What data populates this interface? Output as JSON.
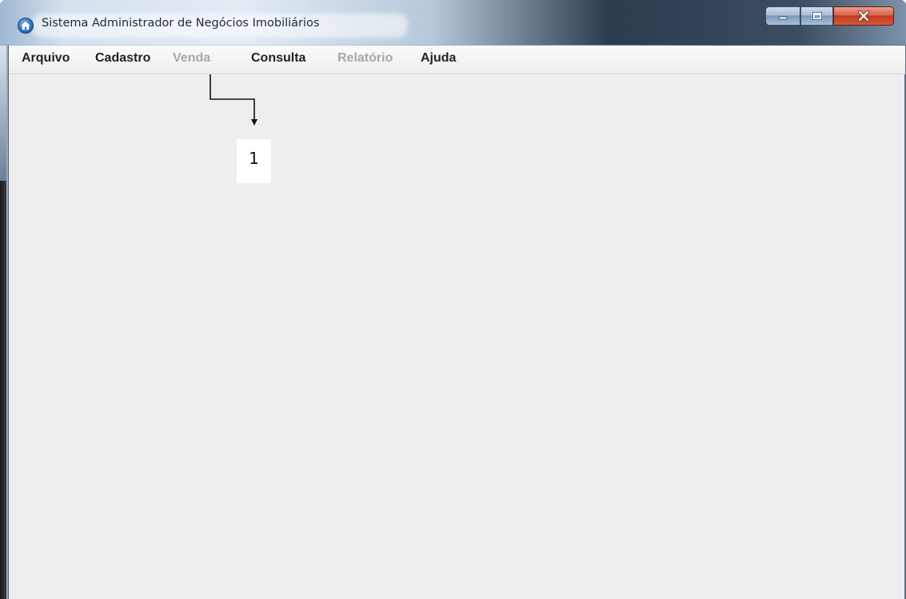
{
  "window": {
    "title": "Sistema Administrador de Negócios Imobiliários",
    "controls": {
      "minimize": "minimize-icon",
      "maximize": "maximize-icon",
      "close": "close-icon"
    }
  },
  "menubar": {
    "items": [
      {
        "label": "Arquivo",
        "enabled": true
      },
      {
        "label": "Cadastro",
        "enabled": true
      },
      {
        "label": "Venda",
        "enabled": false
      },
      {
        "label": "Consulta",
        "enabled": true
      },
      {
        "label": "Relatório",
        "enabled": false
      },
      {
        "label": "Ajuda",
        "enabled": true
      }
    ]
  },
  "annotation": {
    "number": "1"
  },
  "colors": {
    "menu_enabled": "#222222",
    "menu_disabled": "#a8a8a8",
    "client_background": "#eeeeee",
    "close_button": "#c13a1e"
  }
}
